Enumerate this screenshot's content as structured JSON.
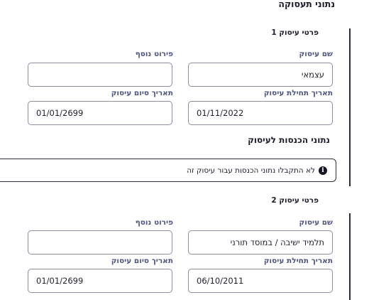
{
  "page_title": "נתוני תעסוקה",
  "businesses": [
    {
      "title": "פרטי עיסוק 1",
      "labels": {
        "name": "שם עיסוק",
        "extra": "פירוט נוסף",
        "start_date": "תאריך תחילת עיסוק",
        "end_date": "תאריך סיום עיסוק"
      },
      "values": {
        "name": "עצמאי",
        "extra": "",
        "start_date": "01/11/2022",
        "end_date": "01/01/2699"
      }
    },
    {
      "title": "פרטי עיסוק 2",
      "labels": {
        "name": "שם עיסוק",
        "extra": "פירוט נוסף",
        "start_date": "תאריך תחילת עיסוק",
        "end_date": "תאריך סיום עיסוק"
      },
      "values": {
        "name": "תלמיד ישיבה / במוסד תורני",
        "extra": "",
        "start_date": "06/10/2011",
        "end_date": "01/01/2699"
      }
    }
  ],
  "income": {
    "title": "נתוני הכנסות לעיסוק",
    "notice_icon": "info-icon",
    "notice_text": "לא התקבלו נתוני הכנסות עבור עיסוק זה"
  }
}
